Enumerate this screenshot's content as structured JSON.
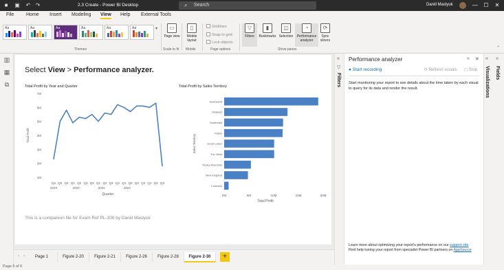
{
  "titlebar": {
    "file_title": "2.3 Create - Power BI Desktop",
    "search_placeholder": "Search",
    "user_name": "Daniil Maslyuk",
    "minimize": "—",
    "maximize": "☐",
    "close": "✕"
  },
  "menu": {
    "items": [
      "File",
      "Home",
      "Insert",
      "Modeling",
      "View",
      "Help",
      "External Tools"
    ],
    "active": "View"
  },
  "ribbon": {
    "themes_label": "Themes",
    "scale_label": "Scale to fit",
    "mobile_label": "Mobile",
    "page_options_label": "Page options",
    "show_panes_label": "Show panes",
    "page_view": "Page view",
    "mobile_layout": "Mobile layout",
    "gridlines": "Gridlines",
    "snap_to_grid": "Snap to grid",
    "lock_objects": "Lock objects",
    "filters": "Filters",
    "bookmarks": "Bookmarks",
    "selection": "Selection",
    "performance_analyzer": "Performance analyzer",
    "sync_slicers": "Sync slicers",
    "theme_sample": "Aa"
  },
  "report": {
    "heading_prefix": "Select",
    "heading_view": "View",
    "heading_sep": ">",
    "heading_pa": "Performance analyzer.",
    "companion": "This is a companion file for Exam Ref PL-300 by Daniil Maslyuk"
  },
  "line_chart": {
    "title": "Total Profit by Year and Quarter",
    "ylabel": "Total Profit",
    "xlabel": "Quarter",
    "y_ticks": [
      "7M",
      "6M",
      "5M",
      "4M",
      "3M",
      "2M",
      "1M"
    ],
    "quarters": [
      "Q2",
      "Q3",
      "Q4",
      "Q1",
      "Q2",
      "Q3",
      "Q4",
      "Q1",
      "Q2",
      "Q3",
      "Q4",
      "Q1",
      "Q2",
      "Q3",
      "Q4",
      "Q1",
      "Q2",
      "Q3"
    ],
    "years": [
      "2019",
      "2020",
      "2021",
      "2022"
    ],
    "color": "#4a81c4"
  },
  "bar_chart": {
    "title": "Total Profit by Sales Territory",
    "ylabel": "Sales Territory",
    "xlabel": "Total Profit",
    "x_ticks": [
      "0M",
      "5M",
      "10M",
      "15M",
      "20M"
    ],
    "color": "#4a81c4"
  },
  "chart_data": [
    {
      "type": "line",
      "title": "Total Profit by Year and Quarter",
      "xlabel": "Quarter",
      "ylabel": "Total Profit",
      "x": [
        "2019 Q2",
        "2019 Q3",
        "2019 Q4",
        "2020 Q1",
        "2020 Q2",
        "2020 Q3",
        "2020 Q4",
        "2021 Q1",
        "2021 Q2",
        "2021 Q3",
        "2021 Q4",
        "2022 Q1",
        "2022 Q2",
        "2022 Q3",
        "2022 Q4",
        "2023 Q1",
        "2023 Q2",
        "2023 Q3"
      ],
      "values": [
        2.3,
        5.0,
        5.8,
        4.9,
        5.3,
        5.2,
        5.5,
        5.0,
        5.6,
        5.5,
        6.2,
        6.0,
        5.7,
        6.1,
        6.1,
        6.0,
        6.3,
        1.8
      ],
      "ylim": [
        1,
        7
      ],
      "grid": false
    },
    {
      "type": "bar",
      "title": "Total Profit by Sales Territory",
      "xlabel": "Total Profit",
      "ylabel": "Sales Territory",
      "categories": [
        "Southwest",
        "Midwest",
        "Southeast",
        "Plains",
        "Great Lakes",
        "Far West",
        "Rocky Mountain",
        "New England",
        "Colorado"
      ],
      "values": [
        19.0,
        12.8,
        11.9,
        11.8,
        10.1,
        10.1,
        5.4,
        4.8,
        0.9
      ],
      "xlim": [
        0,
        20
      ]
    }
  ],
  "page_tabs": {
    "tabs": [
      "Page 1",
      "Figure 2-20",
      "Figure 2-21",
      "Figure 2-26",
      "Figure 2-28",
      "Figure 2-30"
    ],
    "active": "Figure 2-30",
    "add": "+"
  },
  "status": {
    "page_info": "Page 6 of 6"
  },
  "panes": {
    "filters": "Filters",
    "visualizations": "Visualizations",
    "fields": "Fields"
  },
  "perf": {
    "title": "Performance analyzer",
    "start_recording": "Start recording",
    "refresh_visuals": "Refresh visuals",
    "stop": "Stop",
    "description": "Start monitoring your report to see details about the time taken by each visual to query for its data and render the result.",
    "footer_text1": "Learn more about optimizing your report's performance on our ",
    "footer_link1": "support site",
    "footer_text2": "Find help tuning your report from specialist Power BI partners on ",
    "footer_link2": "AppSource"
  }
}
